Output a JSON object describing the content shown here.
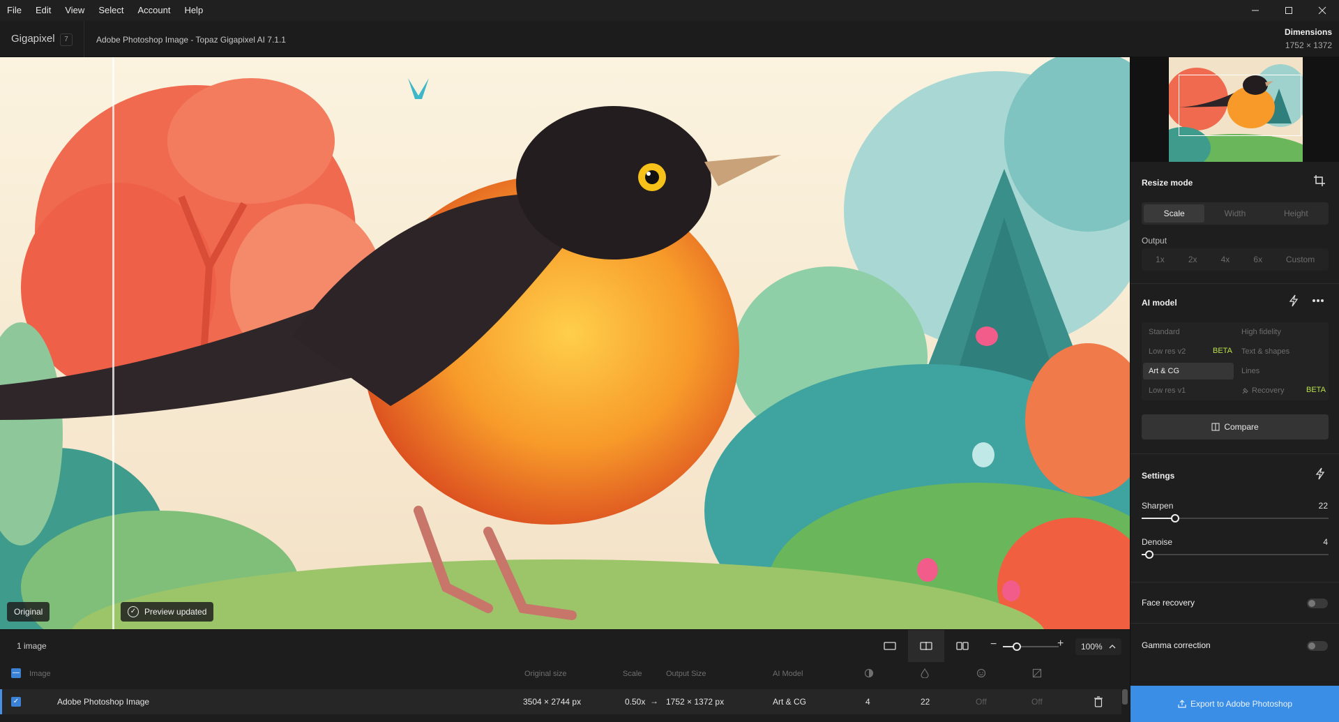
{
  "menu": [
    "File",
    "Edit",
    "View",
    "Select",
    "Account",
    "Help"
  ],
  "window_controls": {
    "minimize": "—",
    "maximize": "☐",
    "close": "✕"
  },
  "app": {
    "name": "Gigapixel",
    "version": "7",
    "doc_title": "Adobe Photoshop Image - Topaz Gigapixel AI 7.1.1"
  },
  "dimensions": {
    "label": "Dimensions",
    "value": "1752 × 1372"
  },
  "canvas": {
    "original_label": "Original",
    "preview_label": "Preview updated"
  },
  "bottom": {
    "count": "1 image",
    "zoom": "100%",
    "zoom_level": 0.25,
    "columns": {
      "image": "Image",
      "original_size": "Original size",
      "scale": "Scale",
      "output_size": "Output Size",
      "ai_model": "AI Model"
    },
    "row": {
      "name": "Adobe Photoshop Image",
      "original_size": "3504 × 2744 px",
      "scale": "0.50x",
      "output_size": "1752 × 1372 px",
      "ai_model": "Art & CG",
      "sharpen": "4",
      "denoise": "22",
      "face": "Off",
      "gamma": "Off"
    }
  },
  "panel": {
    "resize_mode": "Resize mode",
    "resize_options": [
      "Scale",
      "Width",
      "Height"
    ],
    "output_label": "Output",
    "output_options": [
      "1x",
      "2x",
      "4x",
      "6x",
      "Custom"
    ],
    "ai_model": "AI model",
    "models": {
      "standard": "Standard",
      "high_fidelity": "High fidelity",
      "low_res_v2": "Low res v2",
      "text_shapes": "Text & shapes",
      "art_cg": "Art & CG",
      "lines": "Lines",
      "low_res_v1": "Low res v1",
      "recovery": "Recovery",
      "beta": "BETA"
    },
    "compare": "Compare",
    "settings": "Settings",
    "sharpen": {
      "label": "Sharpen",
      "value": "22",
      "fraction": 0.18
    },
    "denoise": {
      "label": "Denoise",
      "value": "4",
      "fraction": 0.04
    },
    "face_recovery": "Face recovery",
    "gamma": "Gamma correction",
    "export": "Export to Adobe Photoshop"
  },
  "colors": {
    "accent": "#3a8ee6",
    "beta": "#b9e14a"
  }
}
